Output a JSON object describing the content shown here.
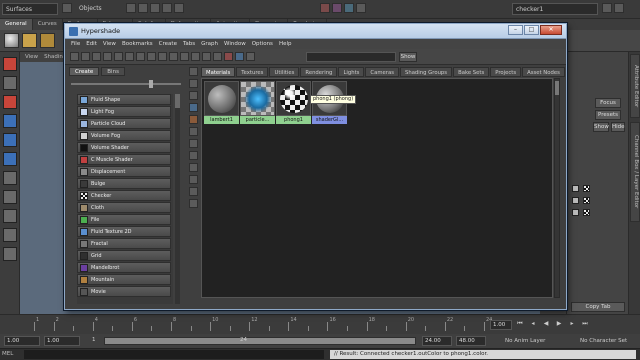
{
  "maya": {
    "mode": "Surfaces",
    "object_mode": "Objects",
    "search_value": "checker1",
    "shelf_tabs": [
      "General",
      "Curves",
      "Surfaces",
      "Polygons",
      "Subdivs",
      "Deformation",
      "Animation",
      "Dynamics",
      "Rendering"
    ],
    "view_menus": [
      "View",
      "Shading"
    ],
    "right_panel": {
      "focus": "Focus",
      "presets": "Presets",
      "show": "Show",
      "hide": "Hide",
      "copy_tab": "Copy Tab"
    },
    "side_tabs": [
      "Attribute Editor",
      "Channel Box / Layer Editor"
    ],
    "timeline": {
      "ticks": [
        "1",
        "2",
        "4",
        "6",
        "8",
        "10",
        "12",
        "14",
        "16",
        "18",
        "20",
        "22",
        "24"
      ],
      "current_frame": "1.00"
    },
    "range": {
      "start": "1.00",
      "inner_start": "1.00",
      "range_start_label": "1",
      "range_end_label": "24",
      "end": "24.00",
      "end2": "48.00",
      "anim_layer": "No Anim Layer",
      "char_set": "No Character Set"
    },
    "cmd": {
      "lang": "MEL",
      "result": "// Result: Connected checker1.outColor to phong1.color."
    }
  },
  "hypershade": {
    "title": "Hypershade",
    "menu": [
      "File",
      "Edit",
      "View",
      "Bookmarks",
      "Create",
      "Tabs",
      "Graph",
      "Window",
      "Options",
      "Help"
    ],
    "show_label": "Show",
    "left_tabs": [
      "Create",
      "Bins"
    ],
    "create_items": [
      {
        "label": "Fluid Shape",
        "color": "#7aa7d8"
      },
      {
        "label": "Light Fog",
        "color": "#c9d7f0"
      },
      {
        "label": "Particle Cloud",
        "color": "#9bb6df"
      },
      {
        "label": "Volume Fog",
        "color": "#d0d0d0"
      },
      {
        "label": "Volume Shader",
        "color": "#111111"
      },
      {
        "label": "C Muscle Shader",
        "color": "#c04040"
      },
      {
        "label": "Displacement",
        "color": "#8a8a8a"
      },
      {
        "label": "Bulge",
        "color": "#3a3a3a"
      },
      {
        "label": "Checker",
        "color": "checker"
      },
      {
        "label": "Cloth",
        "color": "#9e8b6c"
      },
      {
        "label": "File",
        "color": "#4caf50"
      },
      {
        "label": "Fluid Texture 2D",
        "color": "#5a8fd0"
      },
      {
        "label": "Fractal",
        "color": "#777777"
      },
      {
        "label": "Grid",
        "color": "#2f2f2f"
      },
      {
        "label": "Mandelbrot",
        "color": "#6b3fa0"
      },
      {
        "label": "Mountain",
        "color": "#b08040"
      },
      {
        "label": "Movie",
        "color": "#555555"
      }
    ],
    "tabs": [
      "Materials",
      "Textures",
      "Utilities",
      "Rendering",
      "Lights",
      "Cameras",
      "Shading Groups",
      "Bake Sets",
      "Projects",
      "Asset Nodes"
    ],
    "swatches": [
      {
        "name": "lambert1",
        "label_bg": "#8fd08f",
        "kind": "lambert"
      },
      {
        "name": "particle...",
        "label_bg": "#8fd08f",
        "kind": "particle"
      },
      {
        "name": "phong1",
        "label_bg": "#8fd08f",
        "kind": "phong"
      },
      {
        "name": "shaderGl...",
        "label_bg": "#7f8fe0",
        "kind": "shaderglow"
      }
    ],
    "tooltip": "phong1 (phong)"
  }
}
